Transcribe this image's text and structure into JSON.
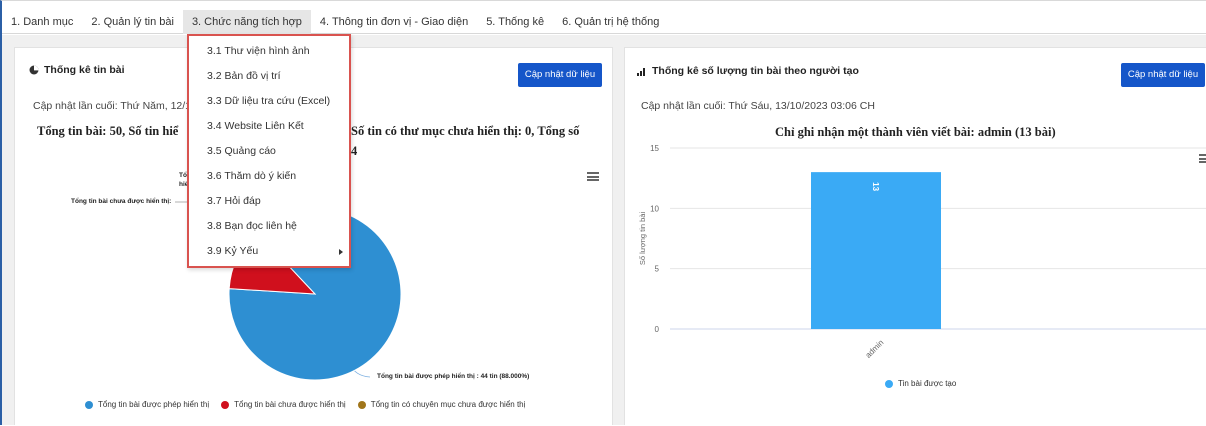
{
  "topnav": {
    "items": [
      {
        "label": "1. Danh mục"
      },
      {
        "label": "2. Quản lý tin bài"
      },
      {
        "label": "3. Chức năng tích hợp"
      },
      {
        "label": "4. Thông tin đơn vị - Giao diện"
      },
      {
        "label": "5. Thống kê"
      },
      {
        "label": "6. Quản trị hệ thống"
      }
    ]
  },
  "dropdown": {
    "items": [
      {
        "label": "3.1 Thư viện hình ảnh"
      },
      {
        "label": "3.2 Bản đồ vị trí"
      },
      {
        "label": "3.3 Dữ liệu tra cứu (Excel)"
      },
      {
        "label": "3.4 Website Liên Kết"
      },
      {
        "label": "3.5 Quảng cáo"
      },
      {
        "label": "3.6 Thăm dò ý kiến"
      },
      {
        "label": "3.7 Hỏi đáp"
      },
      {
        "label": "3.8 Bạn đọc liên hệ"
      },
      {
        "label": "3.9 Kỷ Yếu"
      }
    ]
  },
  "left_panel": {
    "title": "Thống kê tin bài",
    "button": "Cập nhật dữ liệu",
    "updated": "Cập nhật lần cuối: Thứ Năm, 12/1",
    "chart_title_line1_a": "Tổng tin bài: 50, Số tin hiể",
    "chart_title_line1_b": "Số tin có thư mục chưa hiển thị: 0, Tổng số",
    "chart_title_line2": "4",
    "label_partial_1": "Tổ",
    "label_partial_2": "hiể",
    "label_not_shown": "Tổng tin bài chưa được hiển thị:",
    "label_shown": "Tổng tin bài được phép hiển thị : 44 tin (88.000%)",
    "icon": "pie-chart-icon",
    "colors": {
      "shown": "#2e8fd2",
      "not_shown": "#d0101d",
      "folder_hidden": "#a0751a"
    }
  },
  "right_panel": {
    "title": "Thống kê số lượng tin bài theo người tạo",
    "button": "Cập nhật dữ liệu",
    "updated": "Cập nhật lần cuối: Thứ Sáu, 13/10/2023 03:06 CH",
    "icon": "bar-chart-icon"
  },
  "chart_data": [
    {
      "type": "pie",
      "title": "Tổng tin bài: 50, Số tin hiể… Số tin có thư mục chưa hiển thị: 0, Tổng số …4",
      "series": [
        {
          "name": "Tổng tin bài được phép hiển thị",
          "value": 44,
          "percent": 88.0,
          "color": "#2e8fd2"
        },
        {
          "name": "Tổng tin bài chưa được hiển thị",
          "value": 6,
          "percent": 12.0,
          "color": "#d0101d"
        },
        {
          "name": "Tổng tin có chuyên mục chưa được hiển thị",
          "value": 0,
          "percent": 0.0,
          "color": "#a0751a"
        }
      ],
      "legend": "bottom"
    },
    {
      "type": "bar",
      "title": "Chỉ ghi nhận một thành viên viết bài: admin (13 bài)",
      "categories": [
        "admin"
      ],
      "series": [
        {
          "name": "Tin bài được tạo",
          "values": [
            13
          ],
          "color": "#3aaaf5"
        }
      ],
      "ylabel": "Số lượng tin bài",
      "ylim": [
        0,
        15
      ],
      "yticks": [
        "0",
        "5",
        "10",
        "15"
      ],
      "data_label": "13",
      "grid": true,
      "legend": "bottom"
    }
  ]
}
